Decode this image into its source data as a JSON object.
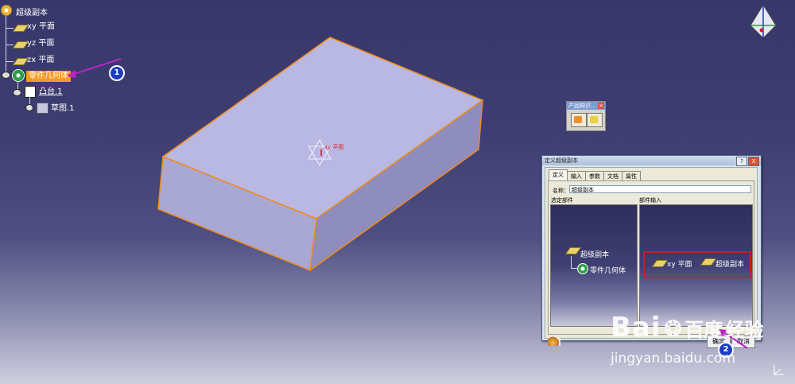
{
  "tree": {
    "root_label": "超级副本",
    "items": [
      {
        "label": "xy 平面"
      },
      {
        "label": "yz 平面"
      },
      {
        "label": "zx 平面"
      }
    ],
    "selected_label": "零件几何体",
    "pad_label": "凸台.1",
    "sketch_label": "草图.1"
  },
  "callouts": {
    "one": "1",
    "two": "2"
  },
  "viewport": {
    "plane_tag": "xy 平面"
  },
  "product_toolbar": {
    "title": "产品知识..."
  },
  "dialog": {
    "title": "定义超级副本",
    "help_btn": "?",
    "close_btn": "X",
    "tabs": [
      {
        "label": "定义"
      },
      {
        "label": "输入"
      },
      {
        "label": "参数"
      },
      {
        "label": "文档"
      },
      {
        "label": "属性"
      }
    ],
    "name_label": "名称：",
    "name_value": "超级副本",
    "left_header": "选定部件",
    "right_header": "部件输入",
    "left_tree": {
      "parent": "超级副本",
      "child": "零件几何体"
    },
    "right_items": {
      "first": "xy 平面",
      "second": "超级副本"
    },
    "buttons": {
      "ok": "确定",
      "cancel": "取消"
    }
  },
  "watermark": {
    "brand": "Bai",
    "brand2": "百度",
    "brand3": "经验",
    "url": "jingyan.baidu.com"
  },
  "colors": {
    "background": "#3e3e72",
    "selection": "#f39b24",
    "part_face": "#b9b8e3",
    "edge": "#f08a1e",
    "callout": "#1e3cc8",
    "highlight_box": "#c0202a"
  }
}
